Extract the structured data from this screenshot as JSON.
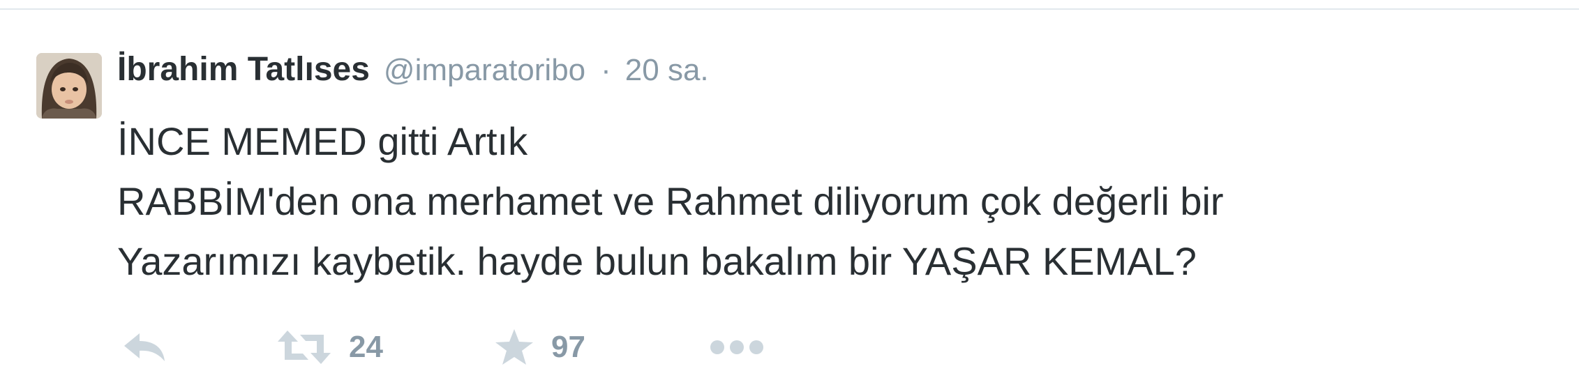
{
  "tweet": {
    "fullname": "İbrahim Tatlıses",
    "username": "@imparatoribo",
    "separator": "·",
    "time": "20 sa.",
    "text_lines": [
      "İNCE MEMED gitti Artık",
      "RABBİM'den ona merhamet ve Rahmet diliyorum çok değerli bir",
      "Yazarımızı kaybetik. hayde bulun bakalım bir YAŞAR KEMAL?"
    ],
    "actions": {
      "reply_icon": "reply-icon",
      "retweet_icon": "retweet-icon",
      "retweet_count": "24",
      "favorite_icon": "star-icon",
      "favorite_count": "97",
      "more_icon": "more-dots-icon"
    }
  },
  "colors": {
    "text": "#292f33",
    "secondary": "#8899a6",
    "icon": "#ccd6dd",
    "divider": "#e1e8ed"
  }
}
